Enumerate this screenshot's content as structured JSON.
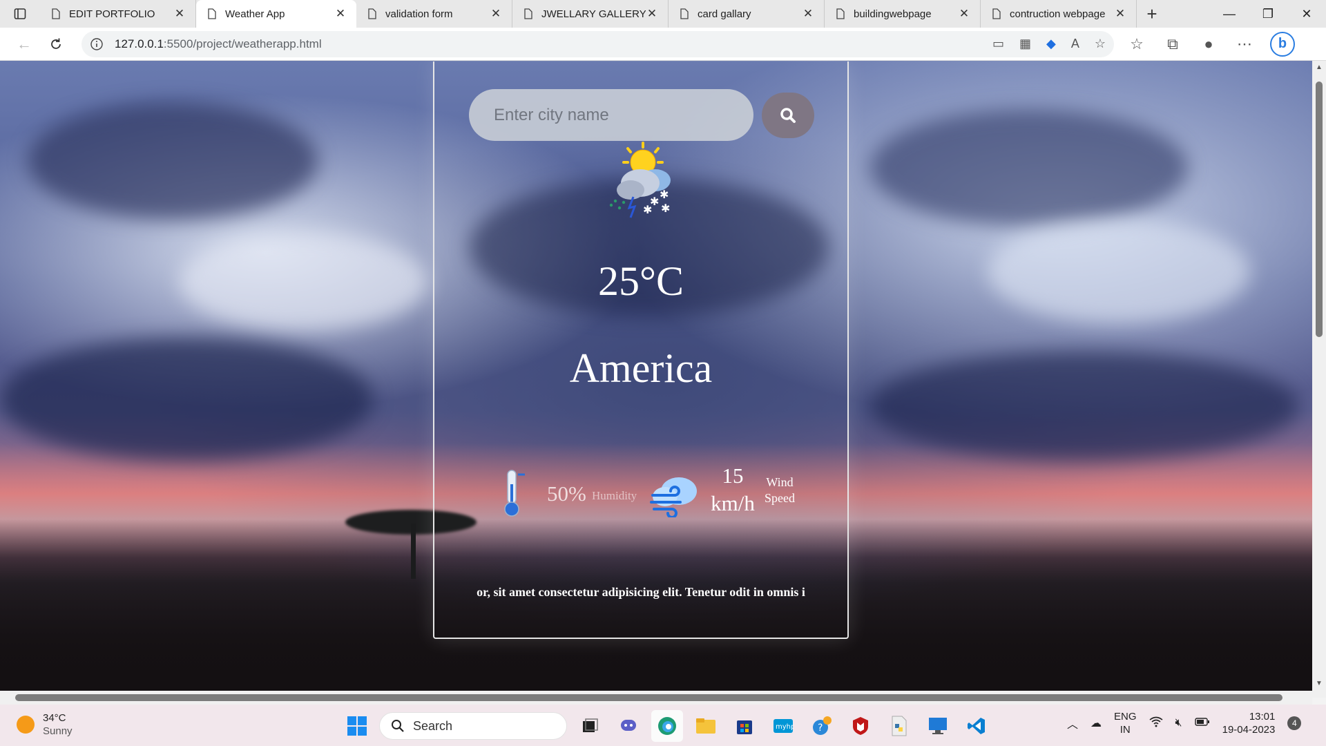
{
  "tabs": [
    {
      "label": "EDIT PORTFOLIO",
      "active": false
    },
    {
      "label": "Weather App",
      "active": true
    },
    {
      "label": "validation form",
      "active": false
    },
    {
      "label": "JWELLARY GALLERY",
      "active": false
    },
    {
      "label": "card gallary",
      "active": false
    },
    {
      "label": "buildingwebpage",
      "active": false
    },
    {
      "label": "contruction webpage",
      "active": false
    }
  ],
  "address_bar": {
    "host": "127.0.0.1",
    "path": ":5500/project/weatherapp.html"
  },
  "weather": {
    "search_placeholder": "Enter city name",
    "temperature": "25°C",
    "city": "America",
    "humidity_value": "50%",
    "humidity_label": "Humidity",
    "wind_value": "15 km/h",
    "wind_label": "Wind Speed",
    "footer_text": "or, sit amet consectetur adipisicing elit. Tenetur odit in omnis i"
  },
  "taskbar": {
    "weather_temp": "34°C",
    "weather_condition": "Sunny",
    "search_label": "Search",
    "language": "ENG",
    "region": "IN",
    "time": "13:01",
    "date": "19-04-2023",
    "notification_count": "4"
  }
}
